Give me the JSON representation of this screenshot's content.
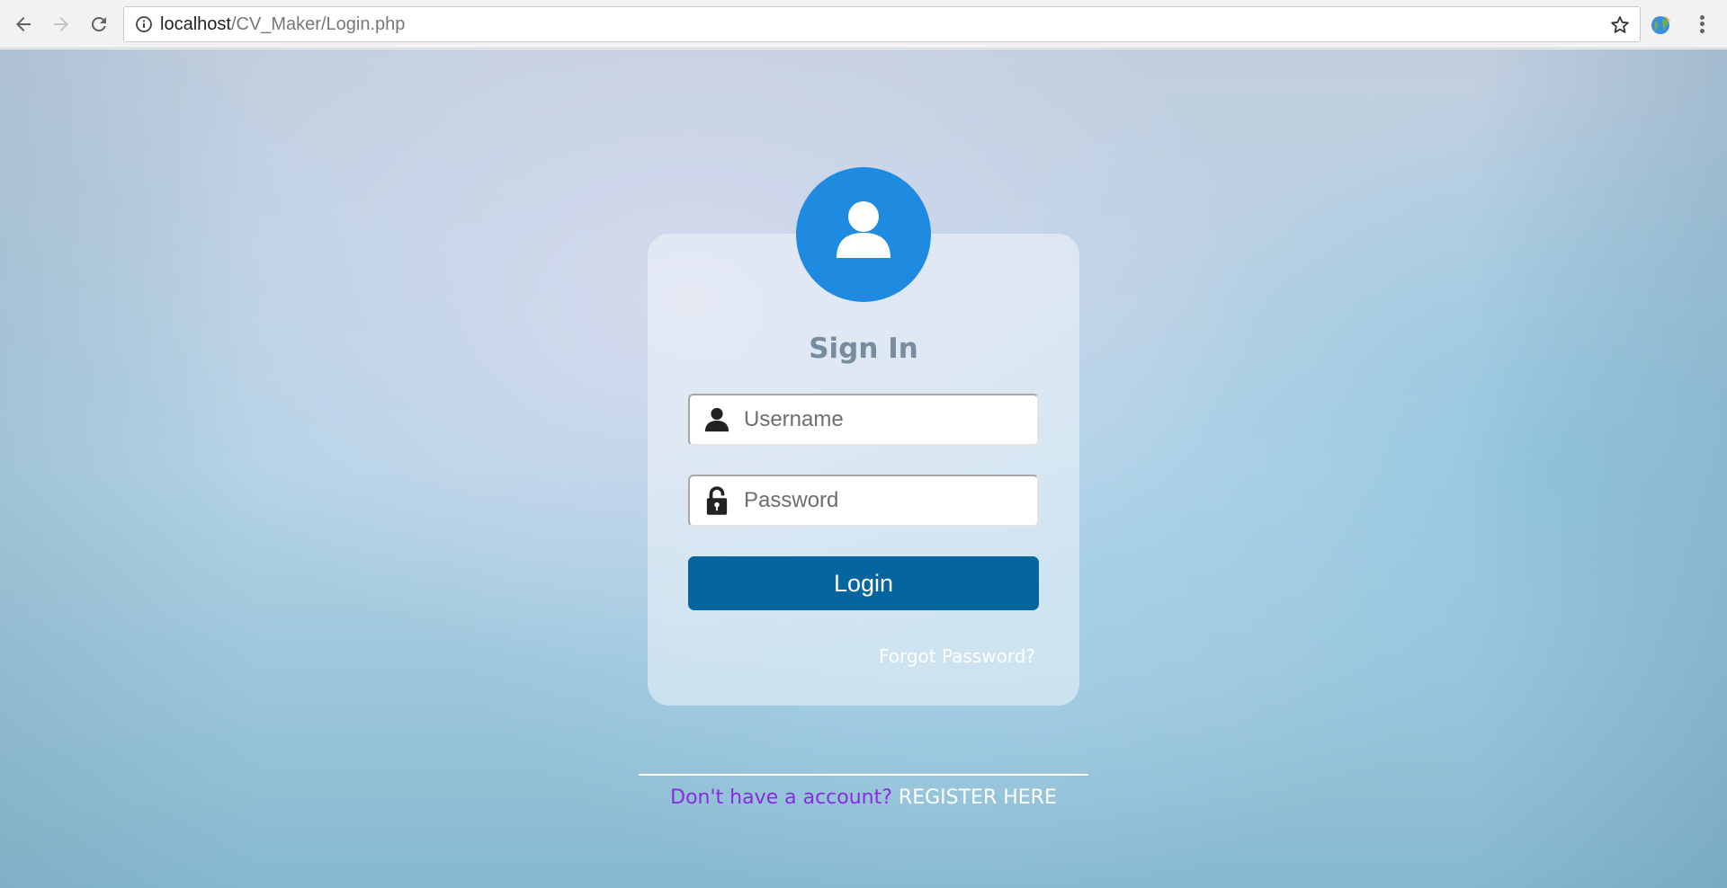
{
  "browser": {
    "url_host": "localhost",
    "url_path": "/CV_Maker/Login.php"
  },
  "login": {
    "title": "Sign In",
    "username_placeholder": "Username",
    "password_placeholder": "Password",
    "login_label": "Login",
    "forgot_label": "Forgot Password?"
  },
  "register": {
    "question": "Don't have a account?",
    "link_label": "REGISTER HERE"
  },
  "colors": {
    "avatar": "#1e8ae0",
    "login_button": "#04659f",
    "register_question": "#8a2be2"
  }
}
